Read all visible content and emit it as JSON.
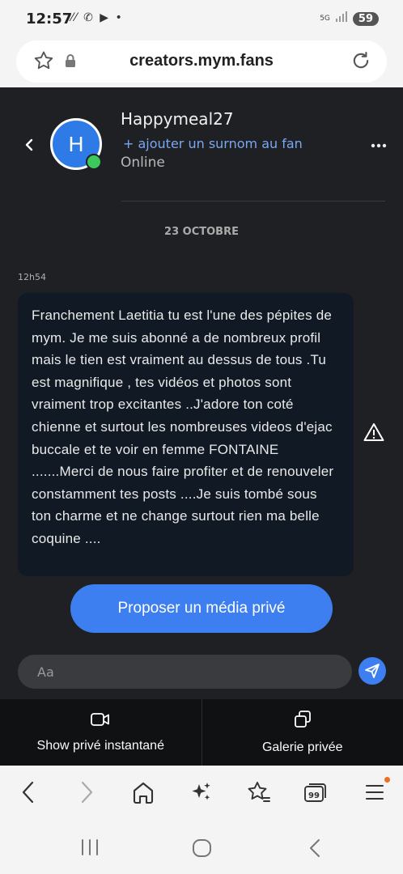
{
  "status_bar": {
    "time": "12:57",
    "left_icons": "⁄⁄ ✆ ▶ •",
    "network": "5G",
    "battery": "59"
  },
  "browser": {
    "url": "creators.mym.fans"
  },
  "chat_header": {
    "avatar_initial": "H",
    "username": "Happymeal27",
    "nickname_link": "+ ajouter un surnom au fan",
    "presence": "Online"
  },
  "conversation": {
    "date_separator": "23 OCTOBRE",
    "message_time": "12h54",
    "message_text": "Franchement Laetitia tu est l'une des pépites de mym. Je me suis abonné a de nombreux profil mais le tien est vraiment au dessus de tous .Tu est magnifique , tes vidéos et photos sont vraiment trop excitantes ..J'adore ton coté chienne et surtout les nombreuses videos d'ejac buccale et te voir en femme FONTAINE .......Merci de nous faire profiter et de renouveler constamment tes posts ....Je suis tombé sous ton charme et ne change surtout rien ma belle coquine ...."
  },
  "actions": {
    "propose_label": "Proposer un média privé",
    "input_placeholder": "Aa"
  },
  "footer_tabs": {
    "show_label": "Show privé instantané",
    "gallery_label": "Galerie privée"
  },
  "browser_nav": {
    "tabs_count": "99"
  },
  "colors": {
    "accent": "#3d7ff0",
    "online": "#3cc85c",
    "app_background": "#1f2023",
    "bubble": "#111a24"
  }
}
